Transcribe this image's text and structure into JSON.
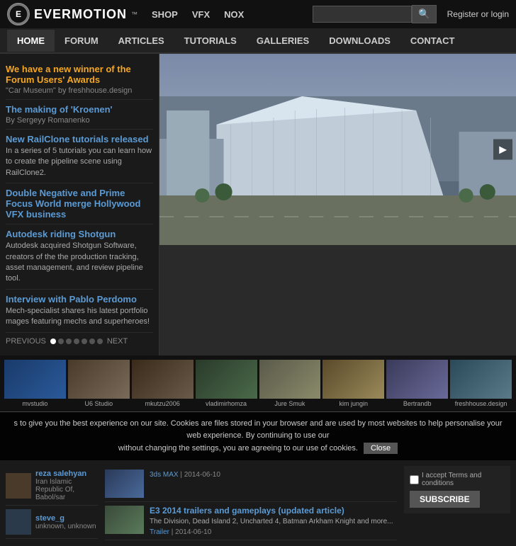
{
  "logo": {
    "circle_text": "E",
    "text": "EVERMOTION",
    "tm": "™"
  },
  "top_nav": {
    "items": [
      {
        "label": "SHOP",
        "href": "#"
      },
      {
        "label": "VFX",
        "href": "#"
      },
      {
        "label": "NOX",
        "href": "#"
      }
    ]
  },
  "search": {
    "placeholder": ""
  },
  "register": "Register or login",
  "main_nav": {
    "items": [
      {
        "label": "HOME",
        "active": true
      },
      {
        "label": "FORUM",
        "active": false
      },
      {
        "label": "ARTICLES",
        "active": false
      },
      {
        "label": "TUTORIALS",
        "active": false
      },
      {
        "label": "GALLERIES",
        "active": false
      },
      {
        "label": "DOWNLOADS",
        "active": false
      },
      {
        "label": "CONTACT",
        "active": false
      }
    ]
  },
  "sidebar": {
    "items": [
      {
        "title": "We have a new winner of the Forum Users' Awards",
        "subtitle": "\"Car Museum\" by freshhouse.design",
        "desc": "",
        "highlight": true
      },
      {
        "title": "The making of 'Kroenen'",
        "subtitle": "By Sergeyy Romanenko",
        "desc": "",
        "highlight": false
      },
      {
        "title": "New RailClone tutorials released",
        "subtitle": "",
        "desc": "In a series of 5 tutorials you can learn how to create the pipeline scene using RailClone2.",
        "highlight": false
      },
      {
        "title": "Double Negative and Prime Focus World merge Hollywood VFX business",
        "subtitle": "",
        "desc": "",
        "highlight": false
      },
      {
        "title": "Autodesk riding Shotgun",
        "subtitle": "",
        "desc": "Autodesk acquired Shotgun Software, creators of the the production tracking, asset management, and review pipeline tool.",
        "highlight": false
      },
      {
        "title": "Interview with Pablo Perdomo",
        "subtitle": "",
        "desc": "Mech-specialist shares his latest portfolio mages featuring mechs and superheroes!",
        "highlight": false
      }
    ],
    "nav": {
      "prev": "PREVIOUS",
      "next": "NEXT",
      "dots": 7,
      "active_dot": 0
    }
  },
  "thumbnails": [
    {
      "label": "mvstudio"
    },
    {
      "label": "U6 Studio"
    },
    {
      "label": "mkutzu2006"
    },
    {
      "label": "vladimirhomza"
    },
    {
      "label": "Jure Smuk"
    },
    {
      "label": "kim jungin"
    },
    {
      "label": "Bertrandb"
    },
    {
      "label": "freshhouse.design"
    }
  ],
  "cookie": {
    "text": "s to give you the best experience on our site. Cookies are files stored in your browser and are used by most websites to help personalise your web experience. By continuing to use our",
    "text2": "without changing the settings, you are agreeing to our use of cookies.",
    "close_label": "Close"
  },
  "users": [
    {
      "name": "reza salehyan",
      "location": "Iran Islamic Republic Of, Babol/sar"
    },
    {
      "name": "steve_g",
      "location": "unknown, unknown"
    }
  ],
  "articles": [
    {
      "title": "3ds MAX  |  2014-06-10",
      "desc": "",
      "tag": "3ds MAX",
      "date": "2014-06-10",
      "thumb_class": "article-thumb-0"
    },
    {
      "title": "E3 2014 trailers and gameplays (updated article)",
      "desc": "The Division, Dead Island 2, Uncharted 4, Batman Arkham Knight and more...",
      "tag": "Trailer",
      "date": "2014-06-10",
      "thumb_class": "article-thumb-1"
    }
  ],
  "subscribe": {
    "checkbox_label": "I accept Terms and conditions",
    "terms_link": "Terms and conditions",
    "button_label": "SUBSCRIBE"
  }
}
